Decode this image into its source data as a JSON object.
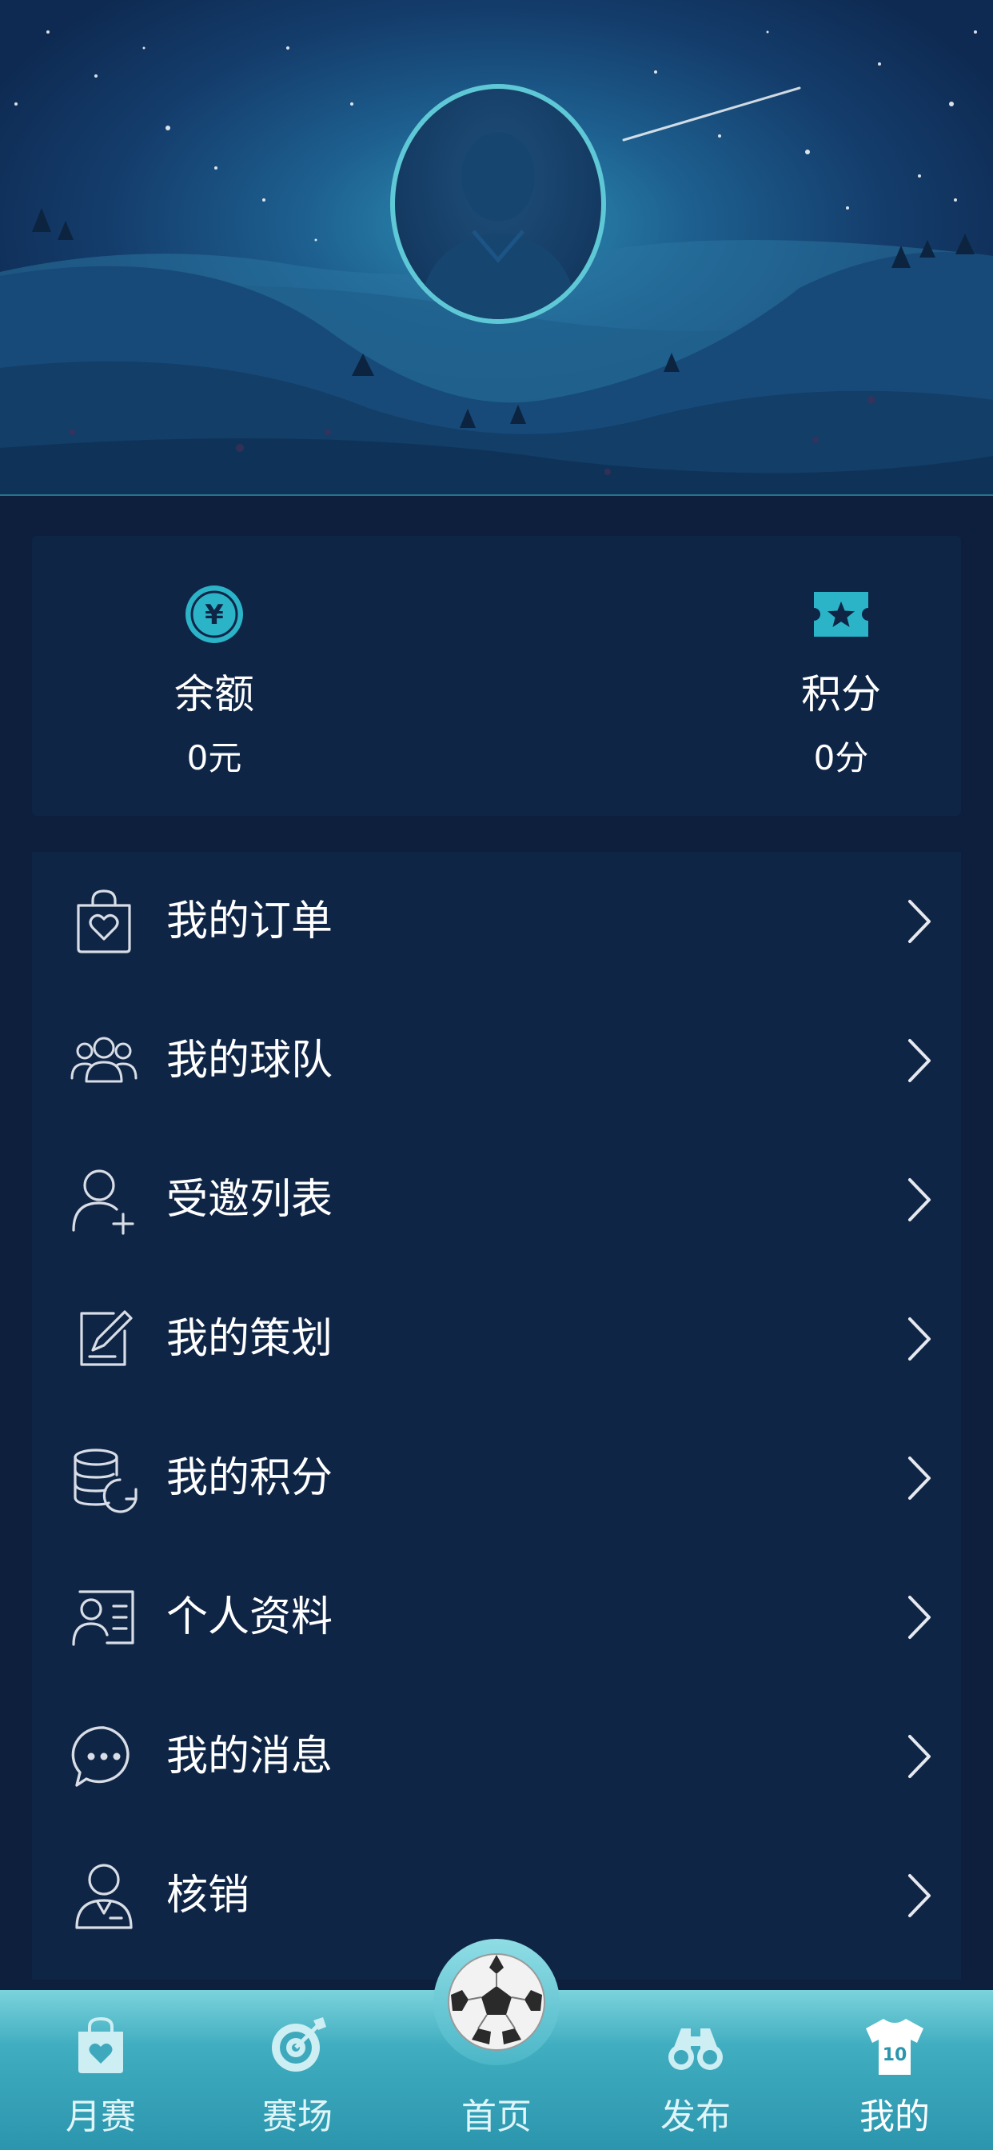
{
  "stats": {
    "balance": {
      "label": "余额",
      "value": "0元",
      "icon": "yen-coin-icon"
    },
    "points": {
      "label": "积分",
      "value": "0分",
      "icon": "ticket-star-icon"
    }
  },
  "menu": {
    "items": [
      {
        "label": "我的订单",
        "icon": "shopping-bag-heart-icon"
      },
      {
        "label": "我的球队",
        "icon": "team-group-icon"
      },
      {
        "label": "受邀列表",
        "icon": "user-add-icon"
      },
      {
        "label": "我的策划",
        "icon": "edit-document-icon"
      },
      {
        "label": "我的积分",
        "icon": "coin-stack-icon"
      },
      {
        "label": "个人资料",
        "icon": "profile-card-icon"
      },
      {
        "label": "我的消息",
        "icon": "chat-bubble-icon"
      },
      {
        "label": "核销",
        "icon": "user-badge-icon"
      }
    ]
  },
  "tabbar": {
    "items": [
      {
        "label": "月赛",
        "icon": "bag-heart-icon",
        "active": false
      },
      {
        "label": "赛场",
        "icon": "target-icon",
        "active": false
      },
      {
        "label": "首页",
        "icon": "soccer-ball-icon",
        "active": false
      },
      {
        "label": "发布",
        "icon": "binoculars-icon",
        "active": false
      },
      {
        "label": "我的",
        "icon": "jersey-icon",
        "active": true
      }
    ],
    "jersey_number": "10"
  },
  "colors": {
    "background": "#0d1f3c",
    "card": "#0f2546",
    "accent": "#2bb3c8",
    "tabbar": "#40adc0"
  }
}
